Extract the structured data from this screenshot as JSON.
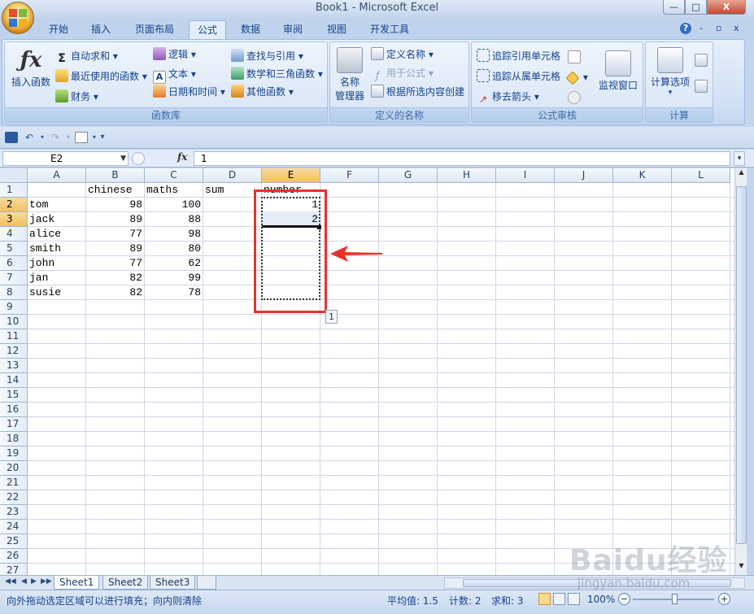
{
  "window": {
    "title": "Book1 - Microsoft Excel",
    "minimize": "—",
    "maximize": "□",
    "close": "X"
  },
  "ribbon_tabs": [
    {
      "label": "开始"
    },
    {
      "label": "插入"
    },
    {
      "label": "页面布局"
    },
    {
      "label": "公式",
      "active": true
    },
    {
      "label": "数据"
    },
    {
      "label": "审阅"
    },
    {
      "label": "视图"
    },
    {
      "label": "开发工具"
    }
  ],
  "ribbon_right": {
    "help": "?",
    "min": "-",
    "restore": "▫",
    "close": "x"
  },
  "ribbon": {
    "function_library": {
      "label": "函数库",
      "insert_function": "插入函数",
      "autosum": "自动求和",
      "recent": "最近使用的函数",
      "financial": "财务",
      "logical": "逻辑",
      "text": "文本",
      "datetime": "日期和时间",
      "lookup": "查找与引用",
      "math": "数学和三角函数",
      "other": "其他函数"
    },
    "defined_names": {
      "label": "定义的名称",
      "name_manager_1": "名称",
      "name_manager_2": "管理器",
      "define_name": "定义名称",
      "use_in_formula": "用于公式",
      "create_from_selection": "根据所选内容创建"
    },
    "formula_auditing": {
      "label": "公式审核",
      "trace_precedents": "追踪引用单元格",
      "trace_dependents": "追踪从属单元格",
      "remove_arrows": "移去箭头",
      "watch_window": "监视窗口"
    },
    "calculation": {
      "label": "计算",
      "calc_options": "计算选项"
    }
  },
  "formula_bar": {
    "name_box": "E2",
    "fx": "fx",
    "value": "1"
  },
  "columns": [
    "A",
    "B",
    "C",
    "D",
    "E",
    "F",
    "G",
    "H",
    "I",
    "J",
    "K",
    "L"
  ],
  "rows": [
    "1",
    "2",
    "3",
    "4",
    "5",
    "6",
    "7",
    "8",
    "9",
    "10",
    "11",
    "12",
    "13",
    "14",
    "15",
    "16",
    "17",
    "18",
    "19",
    "20",
    "21",
    "22",
    "23",
    "24",
    "25",
    "26",
    "27"
  ],
  "sheet": {
    "headers": [
      "",
      "chinese",
      "maths",
      "sum",
      "number"
    ],
    "data": [
      {
        "name": "tom",
        "chinese": "98",
        "maths": "100",
        "number": "1"
      },
      {
        "name": "jack",
        "chinese": "89",
        "maths": "88",
        "number": "2"
      },
      {
        "name": "alice",
        "chinese": "77",
        "maths": "98",
        "number": ""
      },
      {
        "name": "smith",
        "chinese": "89",
        "maths": "80",
        "number": ""
      },
      {
        "name": "john",
        "chinese": "77",
        "maths": "62",
        "number": ""
      },
      {
        "name": "jan",
        "chinese": "82",
        "maths": "99",
        "number": ""
      },
      {
        "name": "susie",
        "chinese": "82",
        "maths": "78",
        "number": ""
      }
    ]
  },
  "fill_tooltip": "1",
  "sheet_tabs": [
    "Sheet1",
    "Sheet2",
    "Sheet3"
  ],
  "status": {
    "message": "向外拖动选定区域可以进行填充；向内则清除",
    "average": "平均值: 1.5",
    "count": "计数: 2",
    "sum": "求和: 3",
    "zoom": "100%"
  },
  "watermark": {
    "brand": "Baidu经验",
    "url": "jingyan.baidu.com"
  },
  "colors": {
    "highlight_red": "#e8322c",
    "selected_header": "#f1c15f"
  }
}
